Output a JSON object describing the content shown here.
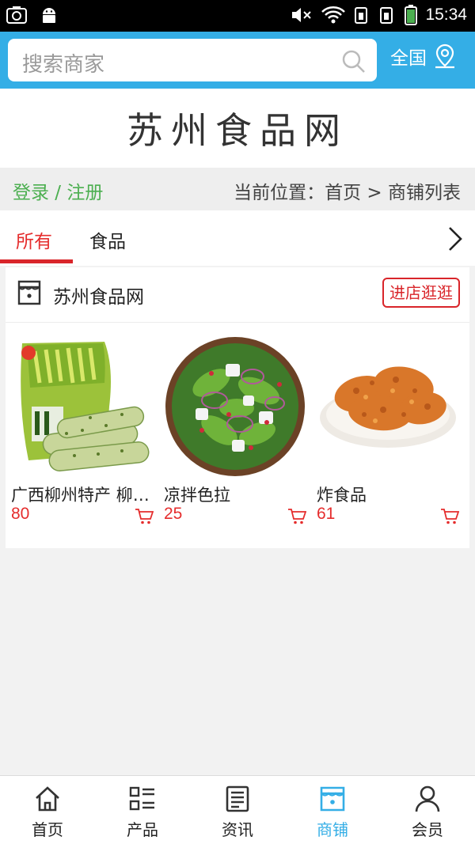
{
  "status_bar": {
    "time": "15:34"
  },
  "search": {
    "placeholder": "搜索商家",
    "region_label": "全国"
  },
  "site_title": "苏州食品网",
  "breadcrumb": {
    "login_label": "登录 / 注册",
    "location": "当前位置：首页 > 商铺列表"
  },
  "tabs": [
    {
      "label": "所有",
      "active": true
    },
    {
      "label": "食品",
      "active": false
    }
  ],
  "shop": {
    "name": "苏州食品网",
    "visit_label": "进店逛逛",
    "products": [
      {
        "name": "广西柳州特产 柳州螺蛳粉",
        "price": "80"
      },
      {
        "name": "凉拌色拉",
        "price": "25"
      },
      {
        "name": "炸食品",
        "price": "61"
      }
    ]
  },
  "bottom_nav": [
    {
      "label": "首页",
      "icon": "home-icon"
    },
    {
      "label": "产品",
      "icon": "list-icon"
    },
    {
      "label": "资讯",
      "icon": "document-icon"
    },
    {
      "label": "商铺",
      "icon": "store-icon",
      "active": true
    },
    {
      "label": "会员",
      "icon": "user-icon"
    }
  ],
  "colors": {
    "accent": "#34aee6",
    "price_red": "#e52d2d",
    "login_green": "#4caf50"
  }
}
